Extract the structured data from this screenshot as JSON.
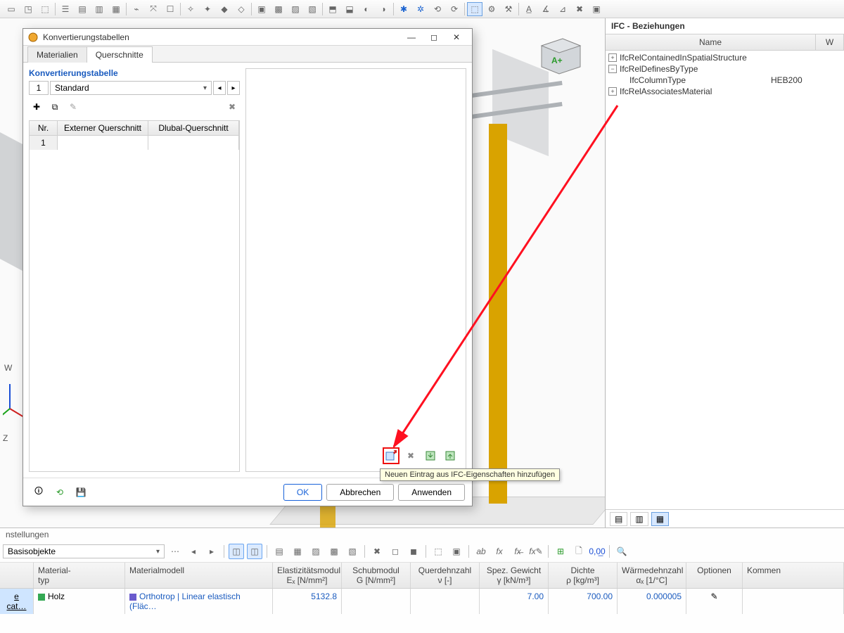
{
  "toolbar_placeholder": " ",
  "dialog": {
    "title": "Konvertierungstabellen",
    "tabs": [
      "Materialien",
      "Querschnitte"
    ],
    "active_tab": 1,
    "section_title": "Konvertierungstabelle",
    "combo_index": "1",
    "combo_value": "Standard",
    "list_headers": {
      "nr": "Nr.",
      "ext": "Externer Querschnitt",
      "dlu": "Dlubal-Querschnitt"
    },
    "list_rows": [
      {
        "nr": "1",
        "ext": "",
        "dlu": ""
      }
    ],
    "tool_clear": "✖",
    "inner_tooltip": "Neuen Eintrag aus IFC-Eigenschaften hinzufügen",
    "buttons": {
      "ok": "OK",
      "cancel": "Abbrechen",
      "apply": "Anwenden"
    }
  },
  "ifc_panel": {
    "title": "IFC - Beziehungen",
    "cols": {
      "name": "Name",
      "val": "W"
    },
    "rows": [
      {
        "exp": "+",
        "indent": 0,
        "name": "IfcRelContainedInSpatialStructure",
        "val": ""
      },
      {
        "exp": "−",
        "indent": 0,
        "name": "IfcRelDefinesByType",
        "val": ""
      },
      {
        "exp": "",
        "indent": 1,
        "name": "IfcColumnType",
        "val": "HEB200"
      },
      {
        "exp": "+",
        "indent": 0,
        "name": "IfcRelAssociatesMaterial",
        "val": ""
      }
    ]
  },
  "bottom": {
    "title": "nstellungen",
    "combo": "Basisobjekte",
    "headers": {
      "a": "e cat",
      "b": "Material-\ntyp",
      "c": "Materialmodell",
      "d": "Elastizitätsmodul\nEₓ [N/mm²]",
      "e": "Schubmodul\nG [N/mm²]",
      "f": "Querdehnzahl\nν [-]",
      "g": "Spez. Gewicht\nγ [kN/m³]",
      "h": "Dichte\nρ [kg/m³]",
      "i": "Wärmedehnzahl\nαₓ [1/°C]",
      "j": "Optionen",
      "k": "Kommen"
    },
    "row": {
      "a": "e cat…",
      "b": "Holz",
      "c": "Orthotrop | Linear elastisch (Fläc…",
      "d": "5132.8",
      "e": "",
      "f": "",
      "g": "7.00",
      "h": "700.00",
      "i": "0.000005",
      "j": "✎",
      "k": ""
    },
    "sw_b": "#34a853",
    "sw_c": "#6a5acd"
  },
  "axis": {
    "w": "W",
    "z": "Z"
  }
}
